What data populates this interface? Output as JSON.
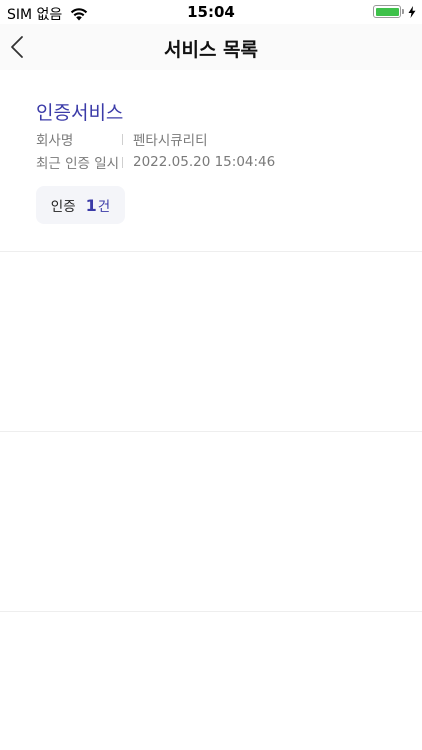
{
  "status_bar": {
    "carrier": "SIM 없음",
    "time": "15:04",
    "battery_color": "#3ec14a"
  },
  "nav": {
    "title": "서비스 목록",
    "back_icon": "chevron-left-icon"
  },
  "services": [
    {
      "name": "인증서비스",
      "company_label": "회사명",
      "company_value": "펜타시큐리티",
      "last_auth_label": "최근 인증 일시",
      "last_auth_value": "2022.05.20 15:04:46",
      "auth_label": "인증",
      "auth_count": "1",
      "auth_unit": "건"
    }
  ],
  "colors": {
    "accent": "#3b3ba8",
    "chip_bg": "#f4f5f9"
  }
}
